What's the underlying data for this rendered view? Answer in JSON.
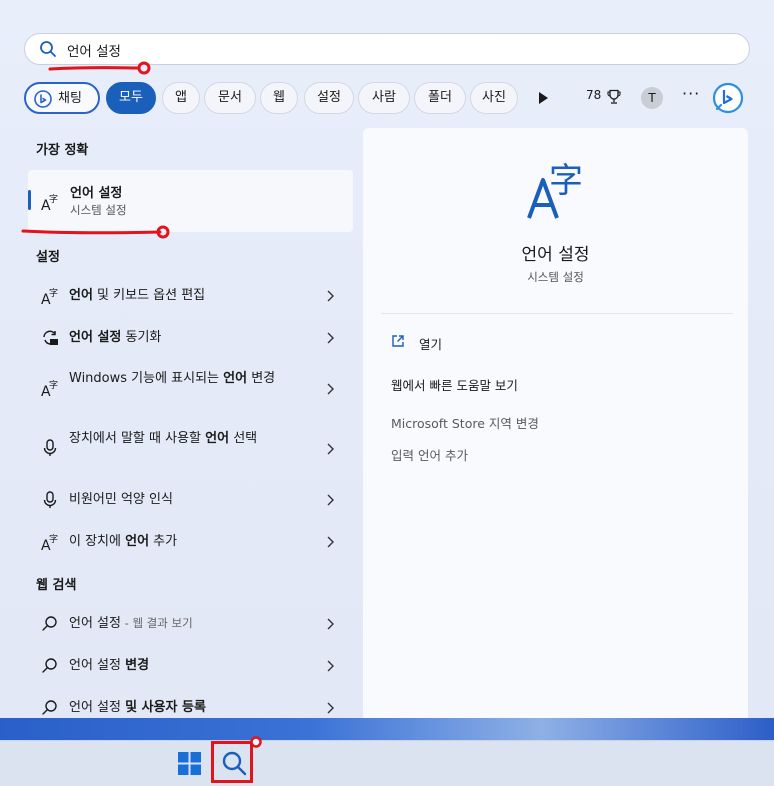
{
  "search": {
    "query": "언어 설정",
    "placeholder": ""
  },
  "filters": {
    "chat": "채팅",
    "items": [
      "모두",
      "앱",
      "문서",
      "웹",
      "설정",
      "사람",
      "폴더",
      "사진"
    ],
    "active": "모두",
    "points": "78",
    "avatar_letter": "T",
    "more": "···"
  },
  "best_match": {
    "heading": "가장 정확",
    "title": "언어 설정",
    "subtitle": "시스템 설정"
  },
  "settings": {
    "heading": "설정",
    "items": [
      {
        "pre": "",
        "bold": "언어",
        "post": " 및 키보드 옵션 편집",
        "icon": "language-icon"
      },
      {
        "pre": "",
        "bold": "언어 설정",
        "post": " 동기화",
        "icon": "sync-icon"
      },
      {
        "pre": "Windows 기능에 표시되는 ",
        "bold": "언어",
        "post": " 변경",
        "icon": "language-icon"
      },
      {
        "pre": "장치에서 말할 때 사용할 ",
        "bold": "언어",
        "post": " 선택",
        "icon": "microphone-icon"
      },
      {
        "pre": "비원어민 억양 인식",
        "bold": "",
        "post": "",
        "icon": "microphone-icon"
      },
      {
        "pre": "이 장치에 ",
        "bold": "언어",
        "post": " 추가",
        "icon": "language-icon"
      }
    ]
  },
  "web": {
    "heading": "웹 검색",
    "items": [
      {
        "pre": "언어 설정",
        "bold": "",
        "post": "",
        "sub": " - 웹 결과 보기"
      },
      {
        "pre": "언어 설정 ",
        "bold": "변경",
        "post": "",
        "sub": ""
      },
      {
        "pre": "언어 설정 ",
        "bold": "및 사용자 등록",
        "post": "",
        "sub": ""
      }
    ]
  },
  "preview": {
    "title": "언어 설정",
    "subtitle": "시스템 설정",
    "actions": [
      "열기",
      "웹에서 빠른 도움말 보기",
      "Microsoft Store 지역 변경",
      "입력 언어 추가"
    ]
  },
  "colors": {
    "accent": "#1a5fba",
    "annotation": "#e3131b"
  }
}
